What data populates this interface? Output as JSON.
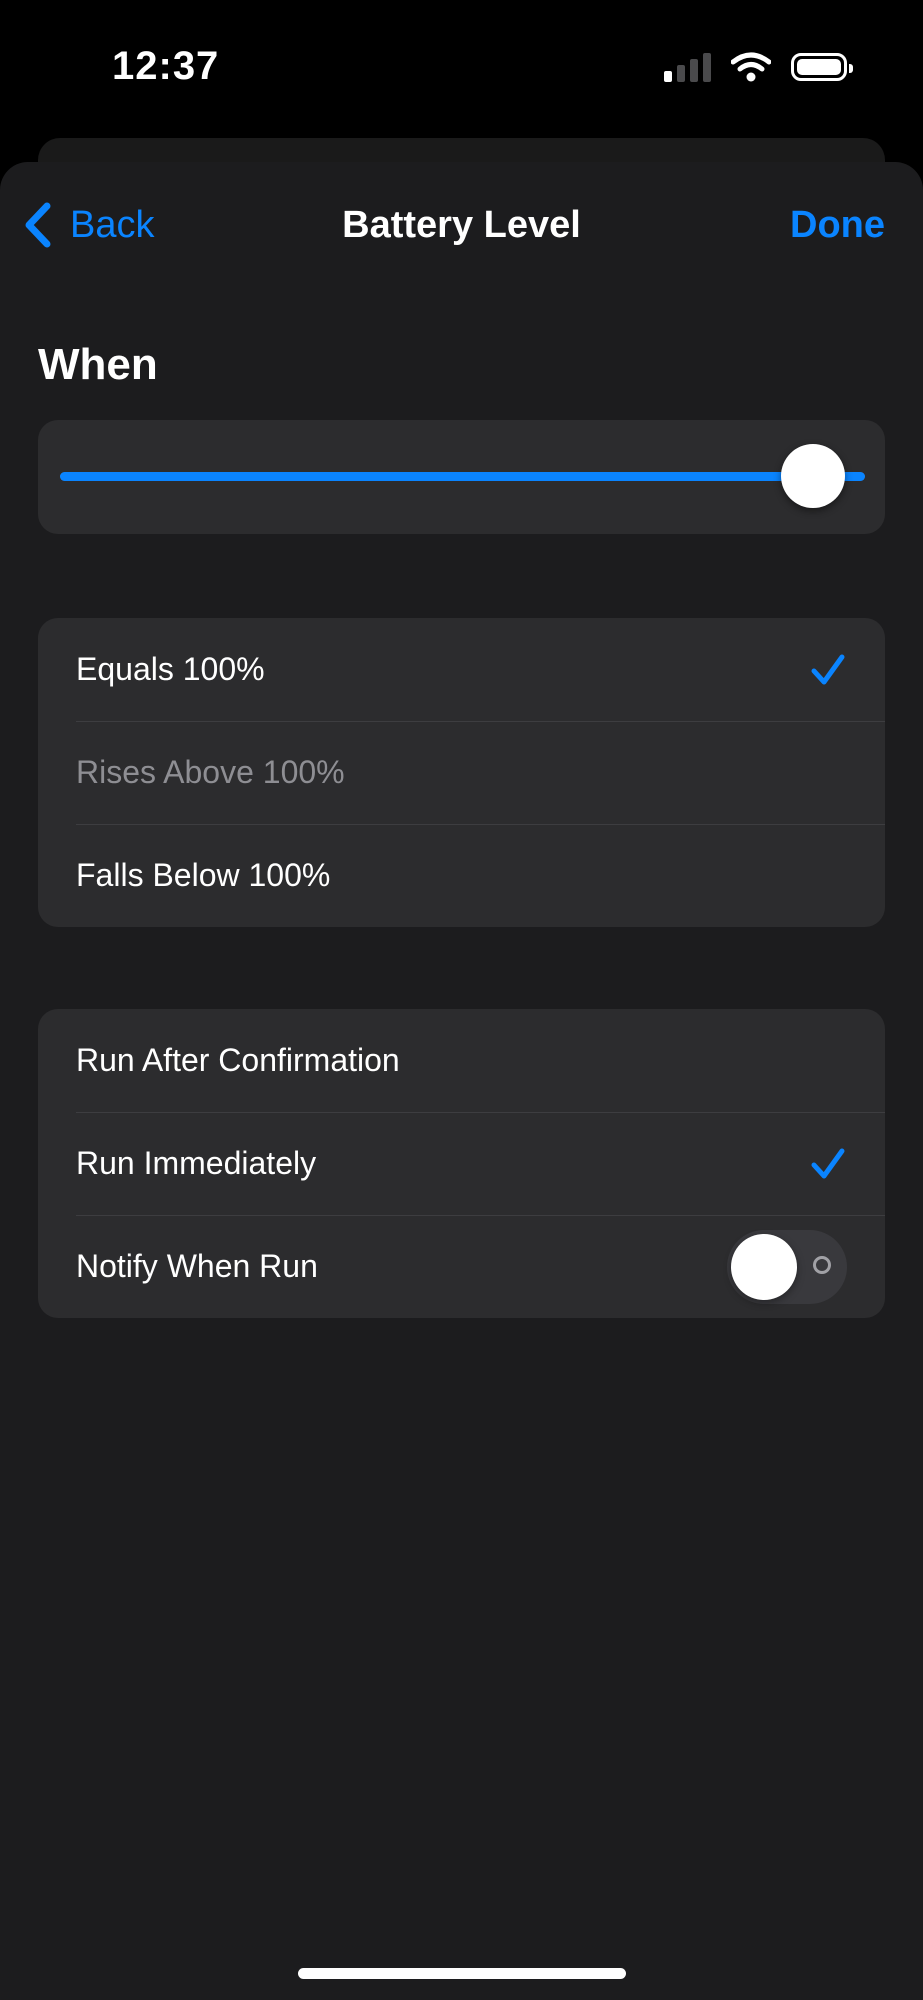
{
  "status_bar": {
    "time": "12:37",
    "icons": [
      "cellular-signal-icon",
      "wifi-icon",
      "battery-icon"
    ],
    "signal_bars_active": 1,
    "signal_bars_total": 4,
    "battery_level": 1.0
  },
  "nav": {
    "back_label": "Back",
    "title": "Battery Level",
    "done_label": "Done"
  },
  "when": {
    "heading": "When",
    "slider_value_fraction": 1.0
  },
  "conditions": [
    {
      "label": "Equals 100%",
      "checked": true,
      "dimmed": false
    },
    {
      "label": "Rises Above 100%",
      "checked": false,
      "dimmed": true
    },
    {
      "label": "Falls Below 100%",
      "checked": false,
      "dimmed": false
    }
  ],
  "run_options": {
    "run_after_confirmation": {
      "label": "Run After Confirmation",
      "checked": false
    },
    "run_immediately": {
      "label": "Run Immediately",
      "checked": true
    },
    "notify_when_run": {
      "label": "Notify When Run",
      "enabled": false
    }
  },
  "colors": {
    "accent": "#0a84ff",
    "background": "#1c1c1e",
    "card": "#2c2c2e",
    "muted_text": "#8e8e93"
  }
}
